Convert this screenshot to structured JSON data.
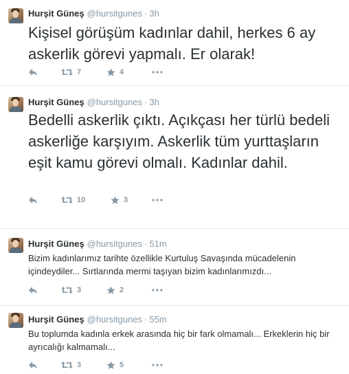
{
  "colors": {
    "muted": "#8899a6",
    "text": "#292f33",
    "divider": "#e1e8ed"
  },
  "icons": [
    "reply-icon",
    "retweet-icon",
    "favorite-icon",
    "more-icon"
  ],
  "tweets": [
    {
      "name": "Hurşit Güneş",
      "handle": "@hursitgunes",
      "dot": "·",
      "time": "3h",
      "text": "Kişisel görüşüm kadınlar dahil, herkes 6 ay askerlik görevi yapmalı. Er olarak!",
      "retweets": "7",
      "favorites": "4"
    },
    {
      "name": "Hurşit Güneş",
      "handle": "@hursitgunes",
      "dot": "·",
      "time": "3h",
      "text": "Bedelli askerlik çıktı. Açıkçası her türlü bedeli askerliğe karşıyım. Askerlik tüm yurttaşların eşit kamu görevi olmalı. Kadınlar dahil.",
      "retweets": "10",
      "favorites": "3"
    },
    {
      "name": "Hurşit Güneş",
      "handle": "@hursitgunes",
      "dot": "·",
      "time": "51m",
      "text": "Bizim kadınlarımız tarihte özellikle Kurtuluş Savaşında mücadelenin içindeydiler... Sırtlarında mermi taşıyan bizim kadınlarımızdı...",
      "retweets": "3",
      "favorites": "2"
    },
    {
      "name": "Hurşit Güneş",
      "handle": "@hursitgunes",
      "dot": "·",
      "time": "55m",
      "text": "Bu toplumda kadınla erkek arasında hiç bir fark olmamalı... Erkeklerin hiç bir ayrıcalığı kalmamalı...",
      "retweets": "3",
      "favorites": "5"
    }
  ]
}
